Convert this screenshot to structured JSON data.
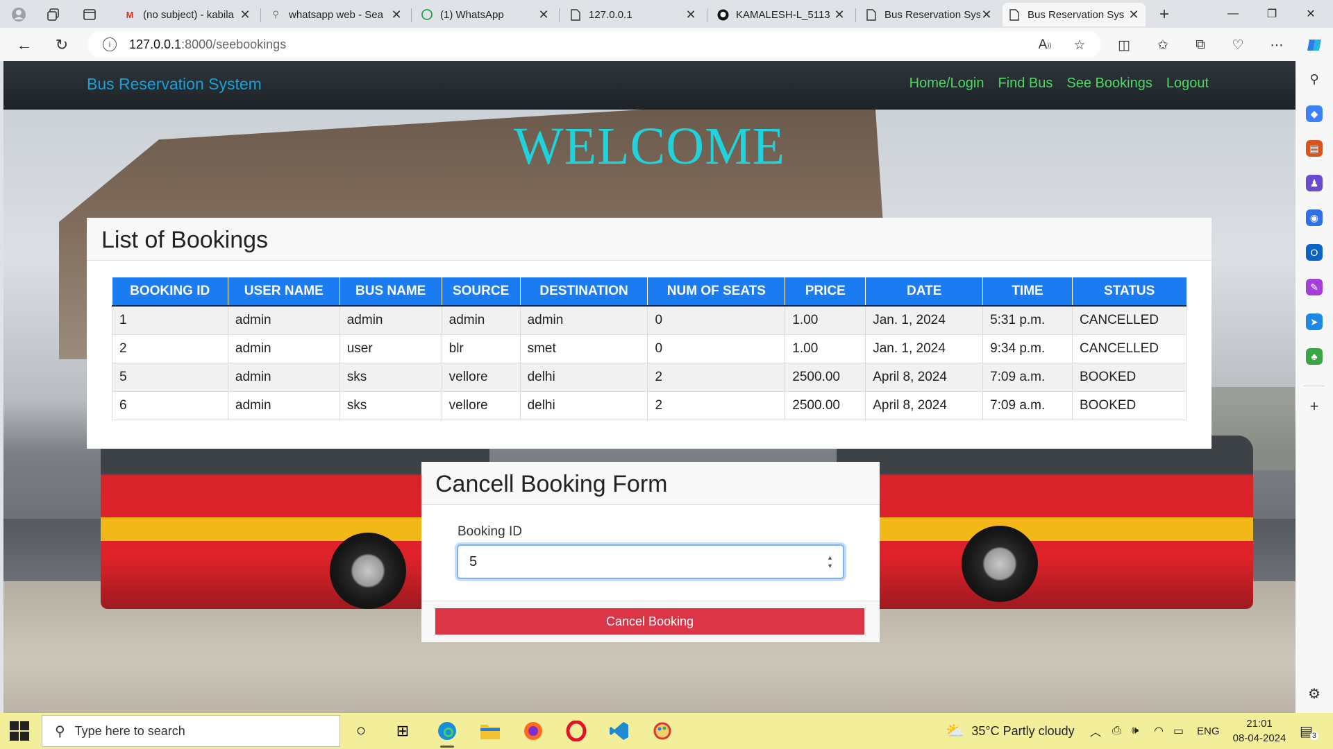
{
  "browser": {
    "tabs": [
      {
        "title": "(no subject) - kabila",
        "icon": "gmail-icon"
      },
      {
        "title": "whatsapp web - Sea",
        "icon": "search-icon"
      },
      {
        "title": "(1) WhatsApp",
        "icon": "whatsapp-icon"
      },
      {
        "title": "127.0.0.1",
        "icon": "page-icon"
      },
      {
        "title": "KAMALESH-L_5113",
        "icon": "github-icon"
      },
      {
        "title": "Bus Reservation Sys",
        "icon": "page-icon"
      },
      {
        "title": "Bus Reservation Sys",
        "icon": "page-icon",
        "active": true
      }
    ],
    "url_host": "127.0.0.1",
    "url_path": ":8000/seebookings"
  },
  "navbar": {
    "brand": "Bus Reservation System",
    "links": [
      "Home/Login",
      "Find Bus",
      "See Bookings",
      "Logout"
    ],
    "link_color": "#4cd964",
    "brand_color": "#17a2d8"
  },
  "welcome": "WELCOME",
  "bookings": {
    "title": "List of Bookings",
    "columns": [
      "BOOKING ID",
      "USER NAME",
      "BUS NAME",
      "SOURCE",
      "DESTINATION",
      "NUM OF SEATS",
      "PRICE",
      "DATE",
      "TIME",
      "STATUS"
    ],
    "rows": [
      [
        "1",
        "admin",
        "admin",
        "admin",
        "admin",
        "0",
        "1.00",
        "Jan. 1, 2024",
        "5:31 p.m.",
        "CANCELLED"
      ],
      [
        "2",
        "admin",
        "user",
        "blr",
        "smet",
        "0",
        "1.00",
        "Jan. 1, 2024",
        "9:34 p.m.",
        "CANCELLED"
      ],
      [
        "5",
        "admin",
        "sks",
        "vellore",
        "delhi",
        "2",
        "2500.00",
        "April 8, 2024",
        "7:09 a.m.",
        "BOOKED"
      ],
      [
        "6",
        "admin",
        "sks",
        "vellore",
        "delhi",
        "2",
        "2500.00",
        "April 8, 2024",
        "7:09 a.m.",
        "BOOKED"
      ]
    ],
    "header_color": "#1a7cf0"
  },
  "cancel_form": {
    "title": "Cancell Booking Form",
    "label": "Booking ID",
    "value": "5",
    "button": "Cancel Booking",
    "button_color": "#dc3545"
  },
  "taskbar": {
    "search_placeholder": "Type here to search",
    "weather": "35°C  Partly cloudy",
    "lang": "ENG",
    "time": "21:01",
    "date": "08-04-2024",
    "notification_count": "3"
  }
}
